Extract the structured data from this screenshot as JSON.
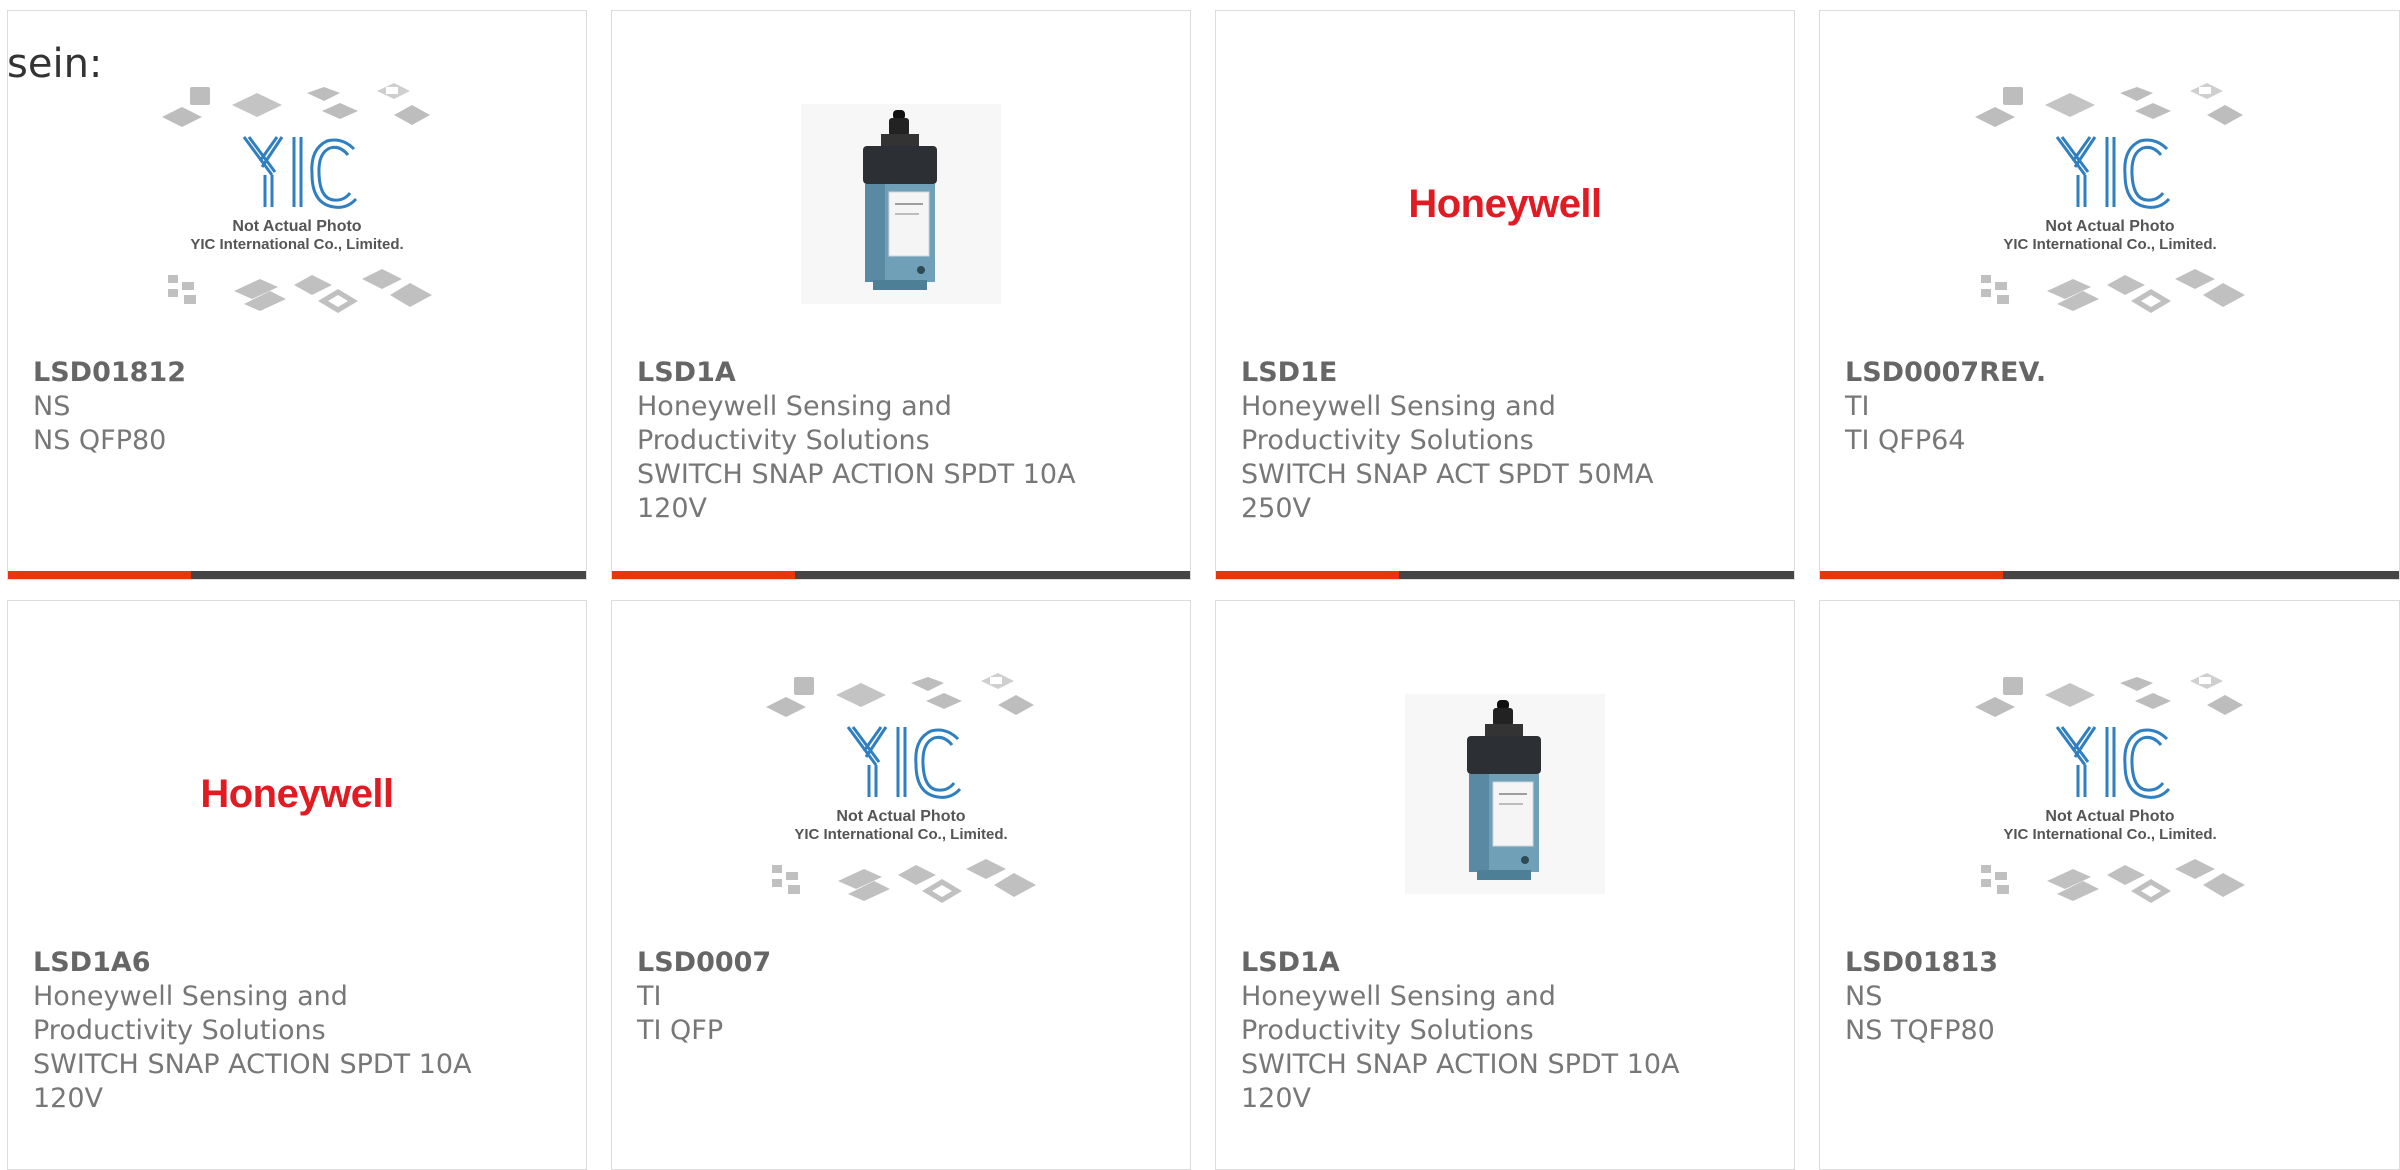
{
  "heading": "sein:",
  "colors": {
    "accent": "#e8350c",
    "bar": "#454545",
    "honeywell_red": "#e01b22",
    "yic_blue": "#2f7fc1"
  },
  "placeholder": {
    "brand": "YIC",
    "line1": "Not Actual Photo",
    "line2": "YIC International Co., Limited."
  },
  "honeywell_logo": "Honeywell",
  "products": [
    {
      "image": "yic-placeholder",
      "part": "LSD01812",
      "lines": [
        "NS",
        "NS QFP80"
      ]
    },
    {
      "image": "limit-switch-photo",
      "part": "LSD1A",
      "lines": [
        "Honeywell Sensing and",
        "Productivity Solutions",
        "SWITCH SNAP ACTION SPDT 10A",
        "120V"
      ]
    },
    {
      "image": "honeywell-logo",
      "part": "LSD1E",
      "lines": [
        "Honeywell Sensing and",
        "Productivity Solutions",
        "SWITCH SNAP ACT SPDT 50MA",
        "250V"
      ]
    },
    {
      "image": "yic-placeholder",
      "part": "LSD0007REV.",
      "lines": [
        "TI",
        "TI QFP64"
      ]
    },
    {
      "image": "honeywell-logo",
      "part": "LSD1A6",
      "lines": [
        "Honeywell Sensing and",
        "Productivity Solutions",
        "SWITCH SNAP ACTION SPDT 10A",
        "120V"
      ]
    },
    {
      "image": "yic-placeholder",
      "part": "LSD0007",
      "lines": [
        "TI",
        "TI QFP"
      ]
    },
    {
      "image": "limit-switch-photo",
      "part": "LSD1A",
      "lines": [
        "Honeywell Sensing and",
        "Productivity Solutions",
        "SWITCH SNAP ACTION SPDT 10A",
        "120V"
      ]
    },
    {
      "image": "yic-placeholder",
      "part": "LSD01813",
      "lines": [
        "NS",
        "NS TQFP80"
      ]
    }
  ]
}
